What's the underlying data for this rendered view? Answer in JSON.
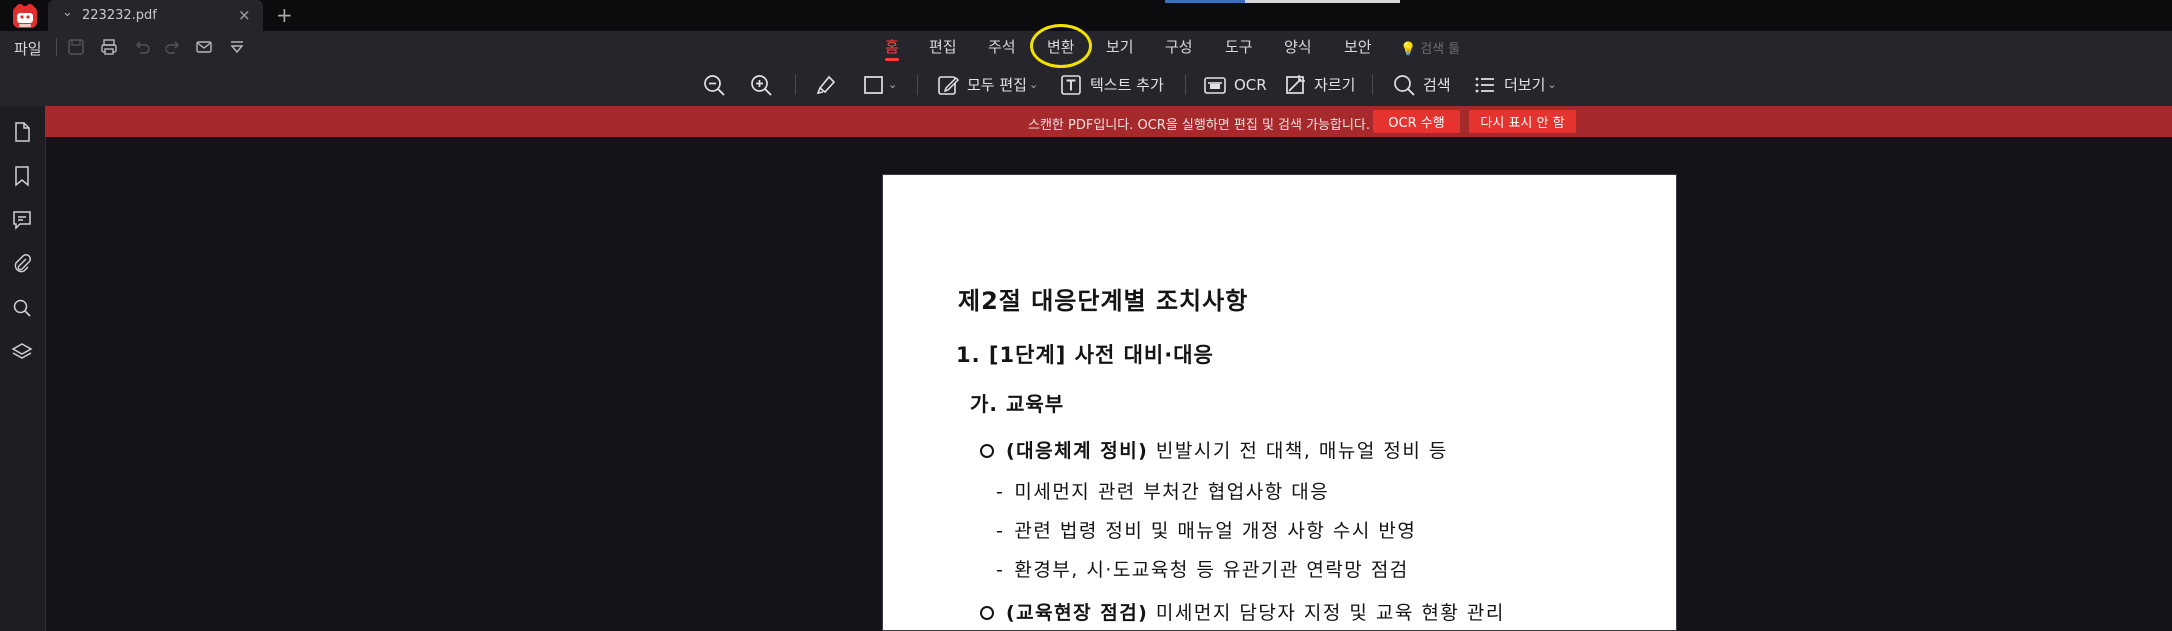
{
  "tab": {
    "filename": "223232.pdf"
  },
  "menu": {
    "file": "파일",
    "tabs": [
      "홈",
      "편집",
      "주석",
      "변환",
      "보기",
      "구성",
      "도구",
      "양식",
      "보안"
    ],
    "search_tools": "검색 툴"
  },
  "toolbar": {
    "edit_all": "모두 편집",
    "add_text": "텍스트 추가",
    "ocr": "OCR",
    "crop": "자르기",
    "search": "검색",
    "more": "더보기"
  },
  "banner": {
    "message": "스캔한 PDF입니다. OCR을 실행하면 편집 및 검색 가능합니다.",
    "run_ocr": "OCR 수행",
    "dont_show": "다시 표시 안 함"
  },
  "document": {
    "section_title": "제2절 대응단계별 조치사항",
    "step_title": "1. [1단계] 사전 대비·대응",
    "ministry": "가. 교육부",
    "bullet1_head": "(대응체계 정비)",
    "bullet1_text": " 빈발시기 전 대책, 매뉴얼 정비 등",
    "dash1": "미세먼지 관련 부처간 협업사항 대응",
    "dash2": "관련 법령 정비 및 매뉴얼 개정 사항 수시 반영",
    "dash3": "환경부, 시·도교육청 등 유관기관 연락망 점검",
    "bullet2_head": "(교육현장 점검)",
    "bullet2_text": " 미세먼지 담당자 지정 및 교육 현황 관리",
    "dash_symbol": "-"
  },
  "colors": {
    "accent_red": "#ff3b3b",
    "banner": "#a6292c",
    "banner_button": "#e5342f",
    "highlight_circle": "#f2e200"
  }
}
